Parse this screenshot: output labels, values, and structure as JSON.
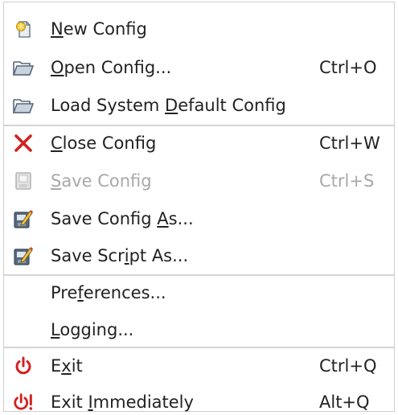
{
  "menu": {
    "items": [
      {
        "pre": "",
        "mn": "N",
        "post": "ew Config",
        "shortcut": "",
        "icon": "new-config-icon",
        "disabled": false
      },
      {
        "pre": "",
        "mn": "O",
        "post": "pen Config...",
        "shortcut": "Ctrl+O",
        "icon": "folder-open-icon",
        "disabled": false
      },
      {
        "pre": "Load System ",
        "mn": "D",
        "post": "efault Config",
        "shortcut": "",
        "icon": "folder-open-icon",
        "disabled": false
      },
      {
        "pre": "",
        "mn": "C",
        "post": "lose Config",
        "shortcut": "Ctrl+W",
        "icon": "close-x-icon",
        "disabled": false
      },
      {
        "pre": "",
        "mn": "S",
        "post": "ave Config",
        "shortcut": "Ctrl+S",
        "icon": "save-icon",
        "disabled": true
      },
      {
        "pre": "Save Config ",
        "mn": "A",
        "post": "s...",
        "shortcut": "",
        "icon": "save-as-icon",
        "disabled": false
      },
      {
        "pre": "Save Scr",
        "mn": "i",
        "post": "pt As...",
        "shortcut": "",
        "icon": "save-as-icon",
        "disabled": false
      },
      {
        "pre": "Pre",
        "mn": "f",
        "post": "erences...",
        "shortcut": "",
        "icon": "",
        "disabled": false
      },
      {
        "pre": "",
        "mn": "L",
        "post": "ogging...",
        "shortcut": "",
        "icon": "",
        "disabled": false
      },
      {
        "pre": "E",
        "mn": "x",
        "post": "it",
        "shortcut": "Ctrl+Q",
        "icon": "power-icon",
        "disabled": false
      },
      {
        "pre": "Exit ",
        "mn": "I",
        "post": "mmediately",
        "shortcut": "Alt+Q",
        "icon": "power-force-icon",
        "disabled": false
      }
    ]
  },
  "colors": {
    "text": "#222222",
    "disabled": "#a8a8a8",
    "accent_red": "#d42020",
    "folder": "#6f8399"
  }
}
